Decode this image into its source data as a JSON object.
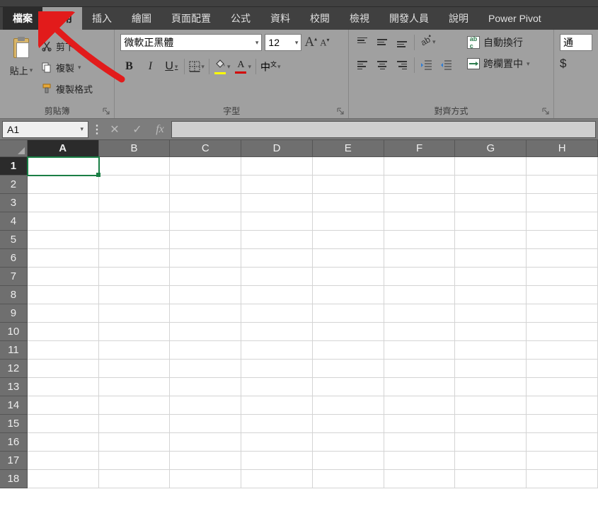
{
  "tabs": {
    "file": "檔案",
    "home": "常用",
    "insert": "插入",
    "draw": "繪圖",
    "layout": "頁面配置",
    "formulas": "公式",
    "data": "資料",
    "review": "校閱",
    "view": "檢視",
    "developer": "開發人員",
    "help": "說明",
    "powerpivot": "Power Pivot"
  },
  "clipboard": {
    "paste": "貼上",
    "cut": "剪下",
    "copy": "複製",
    "formatpainter": "複製格式",
    "group": "剪貼簿"
  },
  "font": {
    "name": "微軟正黑體",
    "size": "12",
    "group": "字型"
  },
  "alignment": {
    "wrap": "自動換行",
    "merge": "跨欄置中",
    "group": "對齊方式"
  },
  "number": {
    "format_short": "通",
    "dollar": "$"
  },
  "formula_bar": {
    "cellref": "A1",
    "fx": "fx"
  },
  "columns": [
    "A",
    "B",
    "C",
    "D",
    "E",
    "F",
    "G",
    "H"
  ],
  "rows": [
    "1",
    "2",
    "3",
    "4",
    "5",
    "6",
    "7",
    "8",
    "9",
    "10",
    "11",
    "12",
    "13",
    "14",
    "15",
    "16",
    "17",
    "18"
  ],
  "active_cell": {
    "col": "A",
    "row": "1"
  }
}
